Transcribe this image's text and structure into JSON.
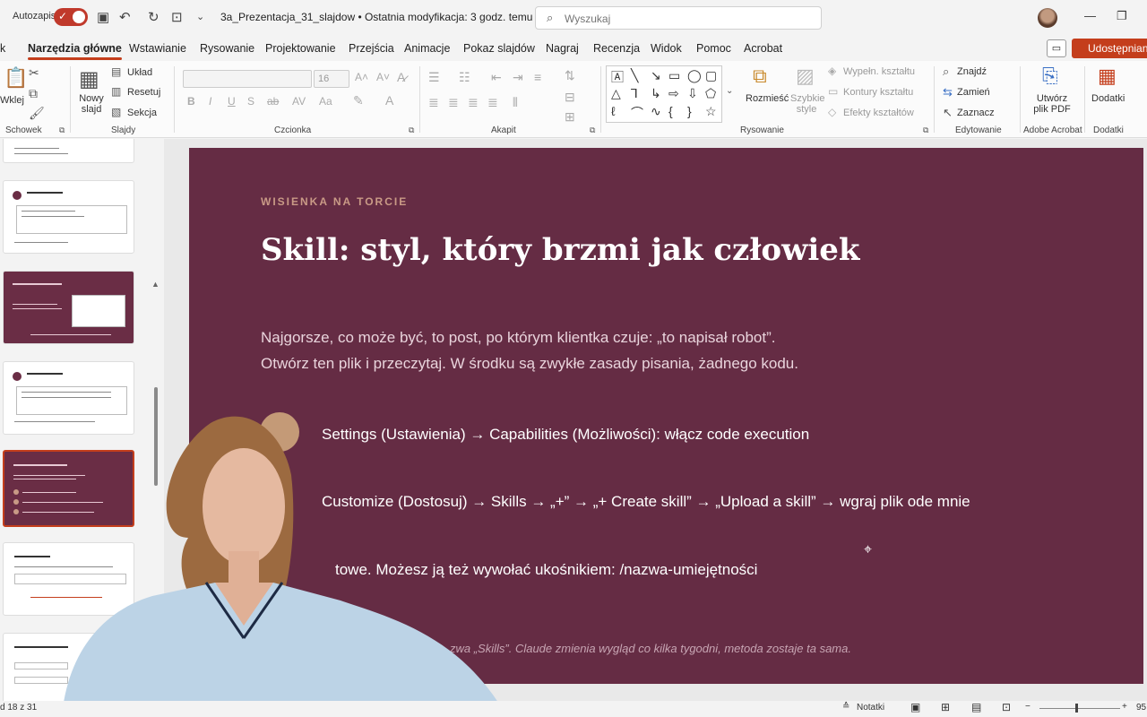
{
  "titlebar": {
    "autosave_label": "Autozapis",
    "document_title": "3a_Prezentacja_31_slajdow • Ostatnia modyfikacja: 3 godz. temu ⌄",
    "search_placeholder": "Wyszukaj"
  },
  "menu": {
    "items": [
      "k",
      "Narzędzia główne",
      "Wstawianie",
      "Rysowanie",
      "Projektowanie",
      "Przejścia",
      "Animacje",
      "Pokaz slajdów",
      "Nagraj",
      "Recenzja",
      "Widok",
      "Pomoc",
      "Acrobat"
    ],
    "active": "Narzędzia główne",
    "share_label": "Udostępnian"
  },
  "ribbon": {
    "paste_label": "Wklej",
    "new_slide_label": "Nowy slajd",
    "layout_label": "Układ",
    "reset_label": "Resetuj",
    "section_label": "Sekcja",
    "font_size": "16",
    "arrange_label": "Rozmieść",
    "quick_styles_label": "Szybkie style",
    "shape_fill_label": "Wypełn. kształtu",
    "shape_outline_label": "Kontury kształtu",
    "shape_effects_label": "Efekty kształtów",
    "find_label": "Znajdź",
    "replace_label": "Zamień",
    "select_label": "Zaznacz",
    "create_pdf_label": "Utwórz plik PDF",
    "addins_label": "Dodatki",
    "groups": {
      "clipboard": "Schowek",
      "slides": "Slajdy",
      "font": "Czcionka",
      "paragraph": "Akapit",
      "drawing": "Rysowanie",
      "editing": "Edytowanie",
      "acrobat": "Adobe Acrobat",
      "addins": "Dodatki"
    }
  },
  "slide": {
    "kicker": "WISIENKA NA TORCIE",
    "title": "Skill: styl, który brzmi jak człowiek",
    "intro_line1": "Najgorsze, co może być, to post, po którym klientka czuje: „to napisał robot”.",
    "intro_line2": "Otwórz ten plik i przeczytaj. W środku są zwykłe zasady pisania, żadnego kodu.",
    "step1": "Settings (Ustawienia) → Capabilities (Możliwości): włącz code execution",
    "step2": "Customize (Dostosuj) → Skills → „+” → „+ Create skill” → „Upload a skill” → wgraj plik ode mnie",
    "step3": "towe. Możesz ją też wywołać ukośnikiem: /nazwa-umiejętności",
    "footnote": "…zwa „Skills”. Claude zmienia wygląd co kilka tygodni, metoda zostaje ta sama."
  },
  "statusbar": {
    "slide_counter": "d 18 z 31",
    "notes_label": "Notatki",
    "zoom": "95"
  },
  "colors": {
    "accent": "#c43e1c",
    "slide_bg": "#652c44",
    "kicker": "#c99a86"
  }
}
